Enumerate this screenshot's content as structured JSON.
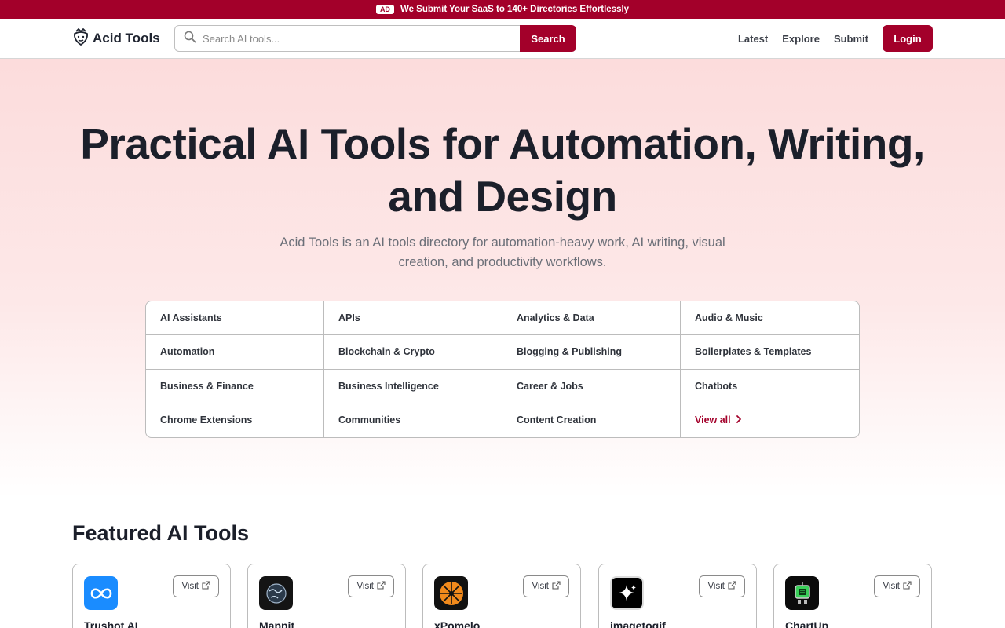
{
  "ad": {
    "badge": "AD",
    "text": "We Submit Your SaaS to 140+ Directories Effortlessly"
  },
  "header": {
    "logo_text": "Acid Tools",
    "search_placeholder": "Search AI tools...",
    "search_button": "Search",
    "nav": [
      "Latest",
      "Explore",
      "Submit"
    ],
    "login": "Login"
  },
  "hero": {
    "title_line1": "Practical AI Tools for Automation, Writing,",
    "title_line2": "and Design",
    "subtitle_line1": "Acid Tools is an AI tools directory for automation-heavy work, AI writing, visual",
    "subtitle_line2": "creation, and productivity workflows."
  },
  "categories": [
    "AI Assistants",
    "APIs",
    "Analytics & Data",
    "Audio & Music",
    "Automation",
    "Blockchain & Crypto",
    "Blogging & Publishing",
    "Boilerplates & Templates",
    "Business & Finance",
    "Business Intelligence",
    "Career & Jobs",
    "Chatbots",
    "Chrome Extensions",
    "Communities",
    "Content Creation"
  ],
  "view_all": "View all",
  "featured": {
    "title": "Featured AI Tools",
    "visit_label": "Visit",
    "tools": [
      {
        "name": "Trushot AI",
        "icon": "infinity-icon",
        "color": "#1a8cff"
      },
      {
        "name": "Mappit",
        "icon": "globe-icon",
        "color": "#141414"
      },
      {
        "name": "xPomelo",
        "icon": "citrus-icon",
        "color": "#111111"
      },
      {
        "name": "imagetogif",
        "icon": "sparkle-icon",
        "color": "#000000"
      },
      {
        "name": "ChartUp",
        "icon": "robot-icon",
        "color": "#0b0b0b"
      }
    ]
  },
  "colors": {
    "brand": "#a3002a",
    "hero_gradient_top": "#fcdcdc"
  }
}
